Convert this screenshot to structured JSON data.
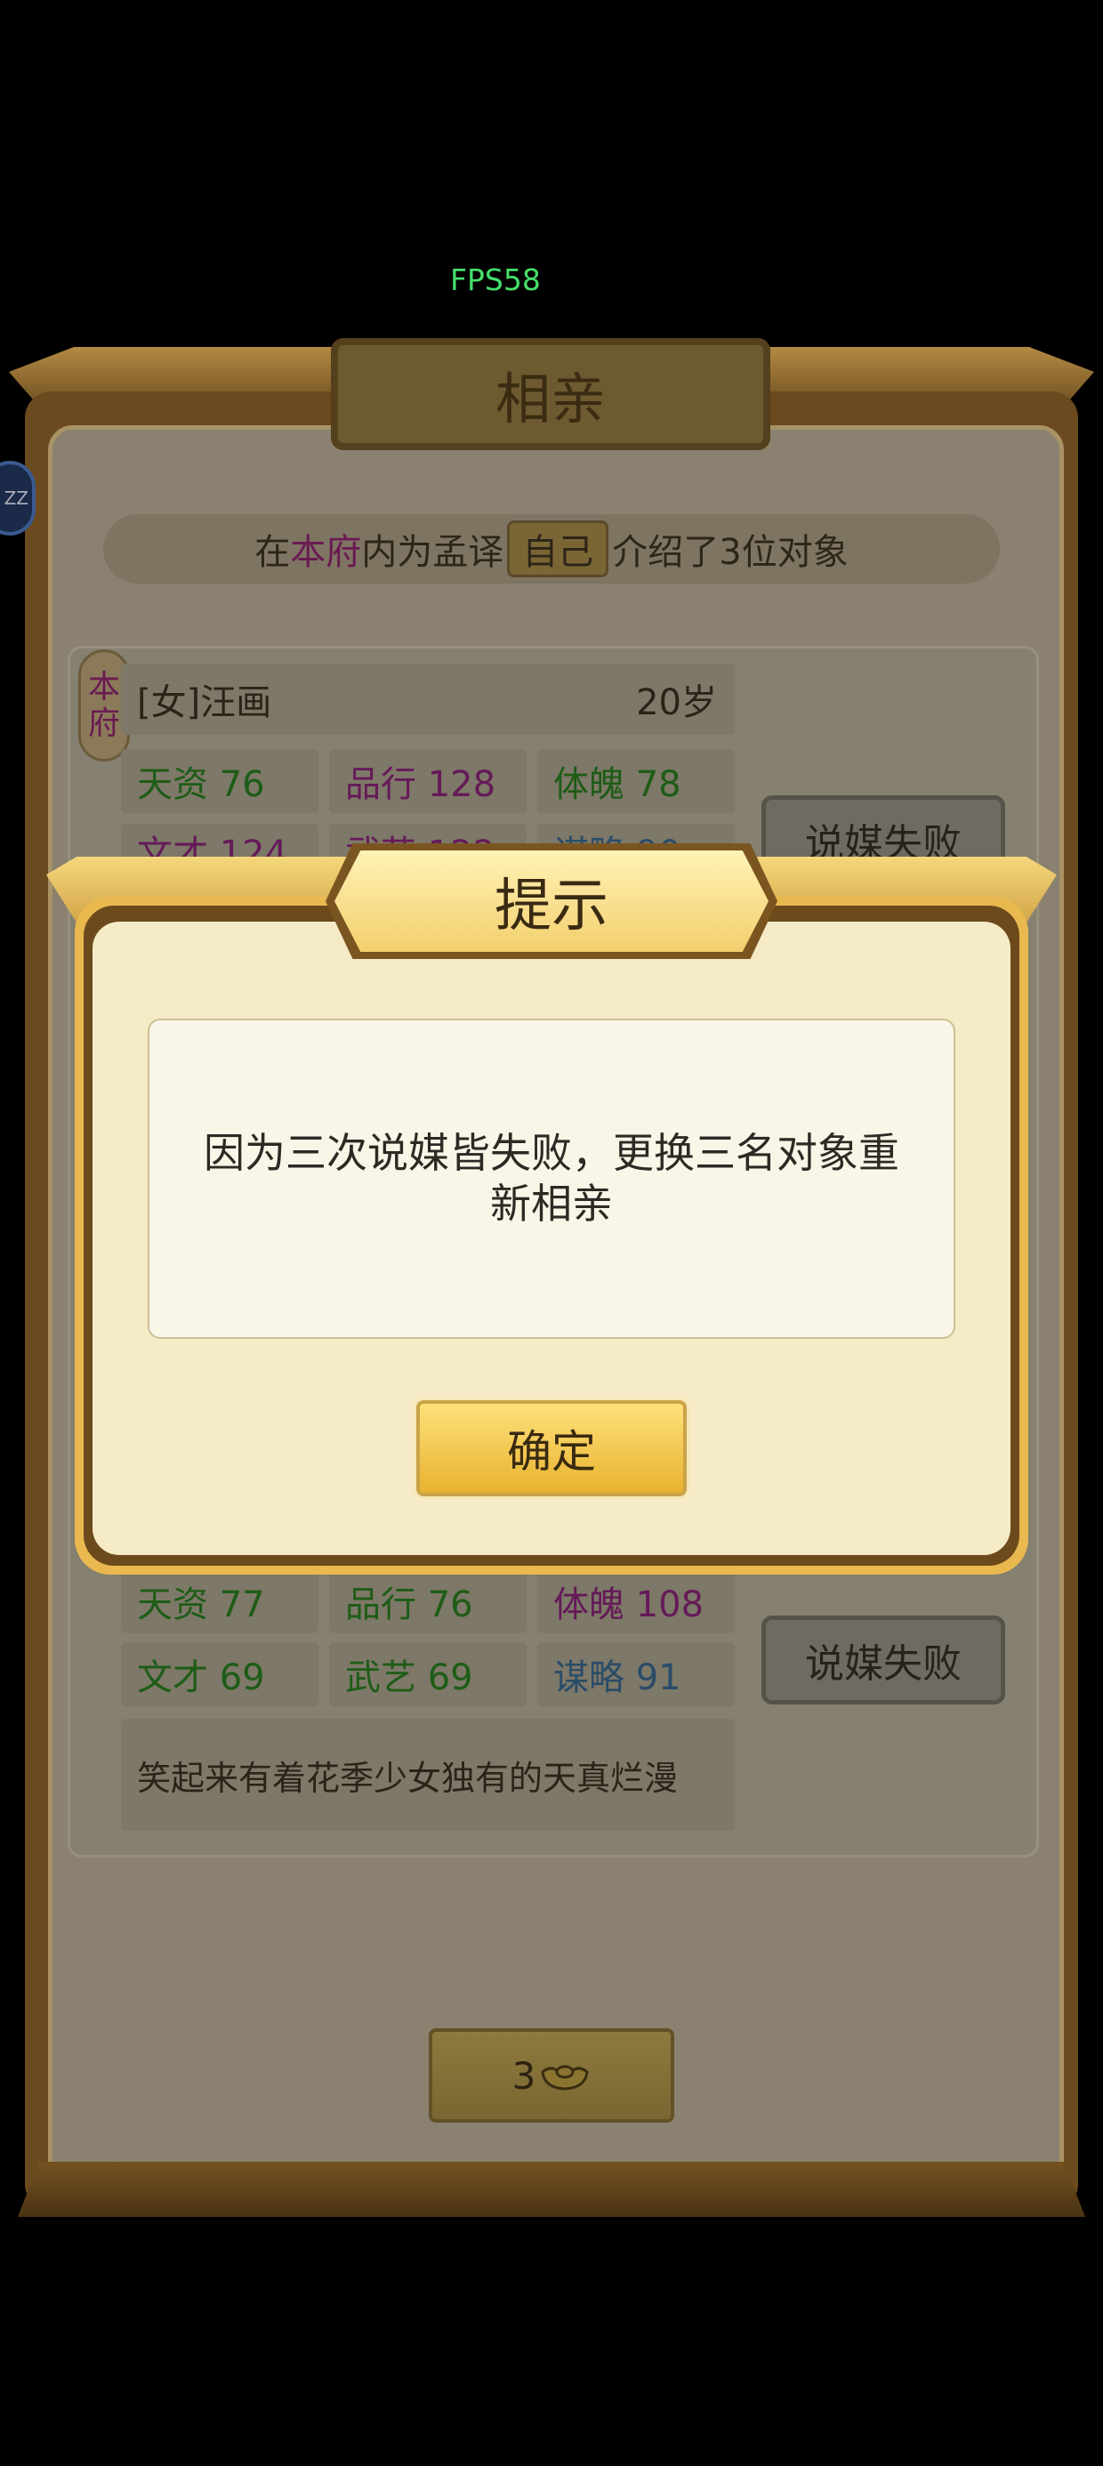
{
  "fps_text": "FPS58",
  "side_avatar_text": "ZZ",
  "page_title": "相亲",
  "intro": {
    "prefix": "在",
    "house": "本府",
    "mid": "内为孟译",
    "self_tag": "自己",
    "suffix": "介绍了3位对象"
  },
  "candidate1": {
    "house_badge": [
      "本",
      "府"
    ],
    "name": "[女]汪画",
    "age": "20岁",
    "stats": [
      {
        "label": "天资 76",
        "color": "green"
      },
      {
        "label": "品行 128",
        "color": "purple"
      },
      {
        "label": "体魄 78",
        "color": "green"
      },
      {
        "label": "文才 124",
        "color": "purple"
      },
      {
        "label": "武艺 122",
        "color": "purple"
      },
      {
        "label": "谋略 90",
        "color": "blue"
      }
    ],
    "status_button": "说媒失败"
  },
  "candidate3": {
    "stats": [
      {
        "label": "天资 77",
        "color": "green"
      },
      {
        "label": "品行 76",
        "color": "green"
      },
      {
        "label": "体魄 108",
        "color": "purple"
      },
      {
        "label": "文才 69",
        "color": "green"
      },
      {
        "label": "武艺 69",
        "color": "green"
      },
      {
        "label": "谋略 91",
        "color": "blue"
      }
    ],
    "status_button": "说媒失败",
    "description": "笑起来有着花季少女独有的天真烂漫"
  },
  "cost_button": {
    "amount": "3",
    "icon": "gold-ingot-icon"
  },
  "dialog": {
    "title": "提示",
    "message": "因为三次说媒皆失败，更换三名对象重新相亲",
    "confirm_label": "确定"
  },
  "colors": {
    "accent_gold": "#e9b950",
    "stat_green": "#1e5c17",
    "stat_purple": "#651a58",
    "stat_blue": "#2a4c68",
    "fps_green": "#46e06a"
  }
}
